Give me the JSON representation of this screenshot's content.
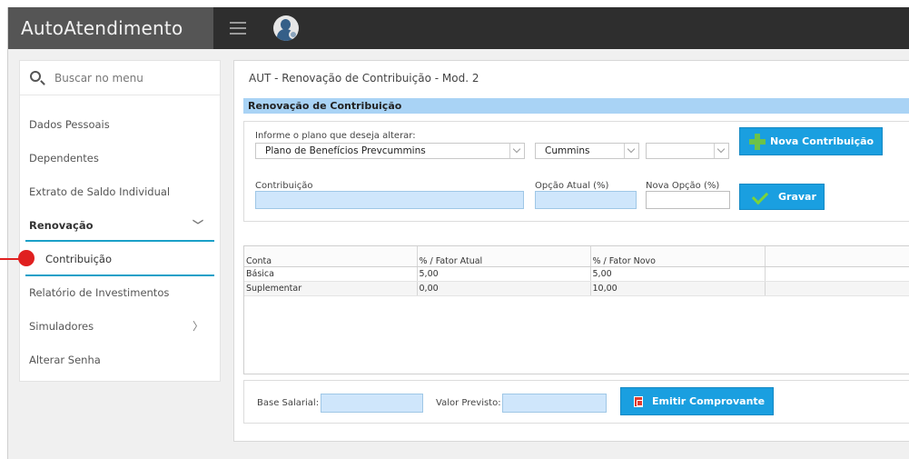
{
  "app": {
    "title": "AutoAtendimento"
  },
  "topbar": {
    "menu_icon": "hamburger-icon",
    "avatar_icon": "user-settings-icon"
  },
  "sidebar": {
    "search_placeholder": "Buscar no menu",
    "items": [
      {
        "label": "Dados Pessoais"
      },
      {
        "label": "Dependentes"
      },
      {
        "label": "Extrato de Saldo Individual"
      },
      {
        "label": "Renovação",
        "expanded": true
      },
      {
        "label": "Contribuição",
        "selected": true
      },
      {
        "label": "Relatório de Investimentos"
      },
      {
        "label": "Simuladores",
        "has_submenu": true
      },
      {
        "label": "Alterar Senha"
      }
    ]
  },
  "panel": {
    "title": "AUT - Renovação de Contribuição - Mod. 2",
    "section": "Renovação de Contribuição",
    "plan_label": "Informe o plano que deseja alterar:",
    "plan_value": "Plano de Benefícios Prevcummins",
    "company_value": "Cummins",
    "third_value": "",
    "new_contribution_button": "Nova Contribuição",
    "contribution_label": "Contribuição",
    "current_option_label": "Opção Atual (%)",
    "new_option_label": "Nova Opção (%)",
    "save_button": "Gravar",
    "table": {
      "headers": [
        "Conta",
        "% / Fator Atual",
        "% / Fator Novo",
        ""
      ],
      "rows": [
        [
          "Básica",
          "5,00",
          "5,00",
          ""
        ],
        [
          "Suplementar",
          "0,00",
          "10,00",
          ""
        ]
      ]
    },
    "salary_label": "Base Salarial:",
    "expected_label": "Valor Previsto:",
    "receipt_button": "Emitir Comprovante"
  },
  "colors": {
    "accent": "#1a9fe0",
    "section_bar": "#a9d3f5",
    "marker": "#e02020"
  }
}
